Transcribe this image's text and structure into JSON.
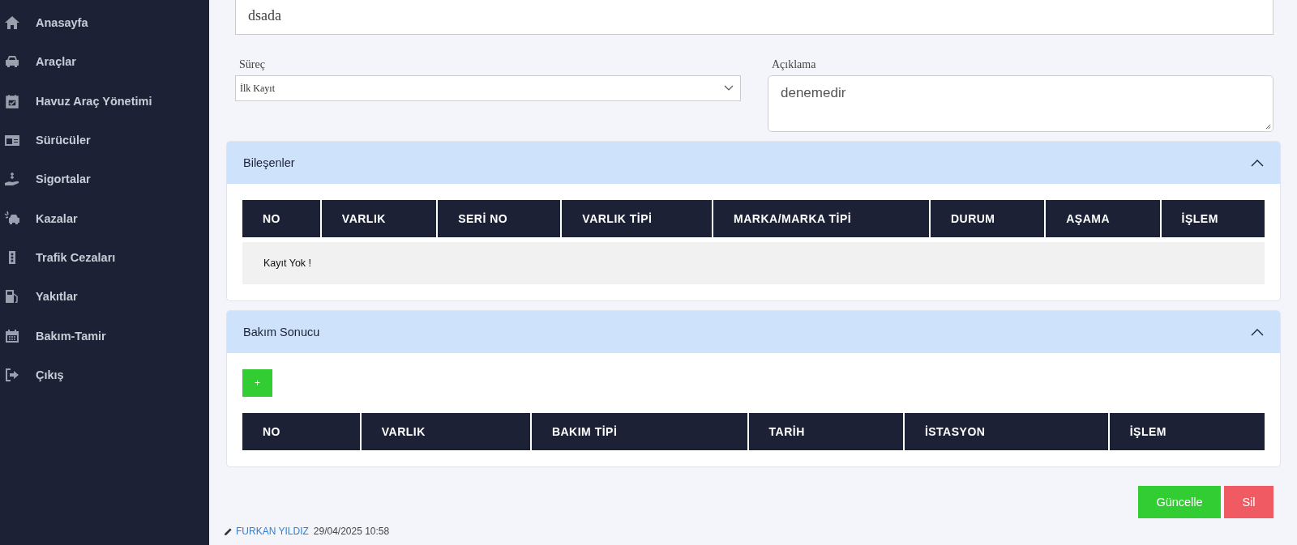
{
  "sidebar": {
    "items": [
      {
        "label": "Anasayfa"
      },
      {
        "label": "Araçlar"
      },
      {
        "label": "Havuz Araç Yönetimi"
      },
      {
        "label": "Sürücüler"
      },
      {
        "label": "Sigortalar"
      },
      {
        "label": "Kazalar"
      },
      {
        "label": "Trafik Cezaları"
      },
      {
        "label": "Yakıtlar"
      },
      {
        "label": "Bakım-Tamir"
      },
      {
        "label": "Çıkış"
      }
    ]
  },
  "top_field": {
    "value": "dsada"
  },
  "process": {
    "label": "Süreç",
    "value": "İlk Kayıt"
  },
  "description": {
    "label": "Açıklama",
    "value": "denemedir"
  },
  "panels": [
    {
      "title": "Bileşenler",
      "expanded": true,
      "columns": [
        "NO",
        "VARLIK",
        "SERİ NO",
        "VARLIK TİPİ",
        "MARKA/MARKA TİPİ",
        "DURUM",
        "AŞAMA",
        "İŞLEM"
      ],
      "empty_text": "Kayıt Yok !"
    },
    {
      "title": "Bakım Sonucu",
      "expanded": true,
      "add_button": "+",
      "columns": [
        "NO",
        "VARLIK",
        "BAKIM TİPİ",
        "TARİH",
        "İSTASYON",
        "İŞLEM"
      ]
    }
  ],
  "actions": [
    {
      "kind": "update",
      "label": "Güncelle"
    },
    {
      "kind": "delete",
      "label": "Sil"
    }
  ],
  "footer": {
    "author": "FURKAN YILDIZ",
    "timestamp": "29/04/2025 10:58"
  }
}
